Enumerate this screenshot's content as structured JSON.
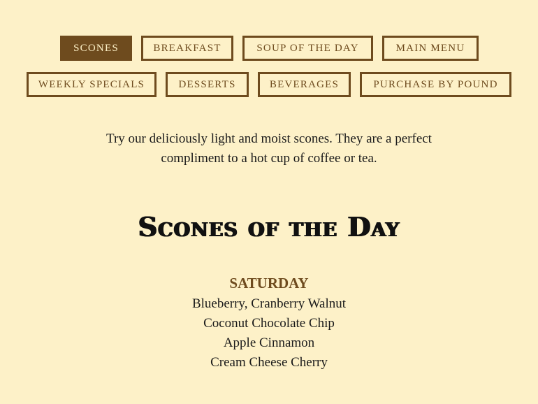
{
  "nav": {
    "tabs": [
      {
        "label": "SCONES",
        "active": true
      },
      {
        "label": "BREAKFAST",
        "active": false
      },
      {
        "label": "SOUP OF THE DAY",
        "active": false
      },
      {
        "label": "MAIN MENU",
        "active": false
      },
      {
        "label": "WEEKLY SPECIALS",
        "active": false
      },
      {
        "label": "DESSERTS",
        "active": false
      },
      {
        "label": "BEVERAGES",
        "active": false
      },
      {
        "label": "PURCHASE BY POUND",
        "active": false
      }
    ]
  },
  "intro": "Try our deliciously light and moist scones. They are a perfect compliment to a hot cup of coffee or tea.",
  "section_title": "Scones of the Day",
  "day": "SATURDAY",
  "scones": [
    "Blueberry, Cranberry Walnut",
    "Coconut Chocolate Chip",
    "Apple Cinnamon",
    "Cream Cheese Cherry"
  ],
  "colors": {
    "background": "#fdf1c8",
    "accent": "#6e4b1e",
    "text": "#1a1a1a"
  }
}
